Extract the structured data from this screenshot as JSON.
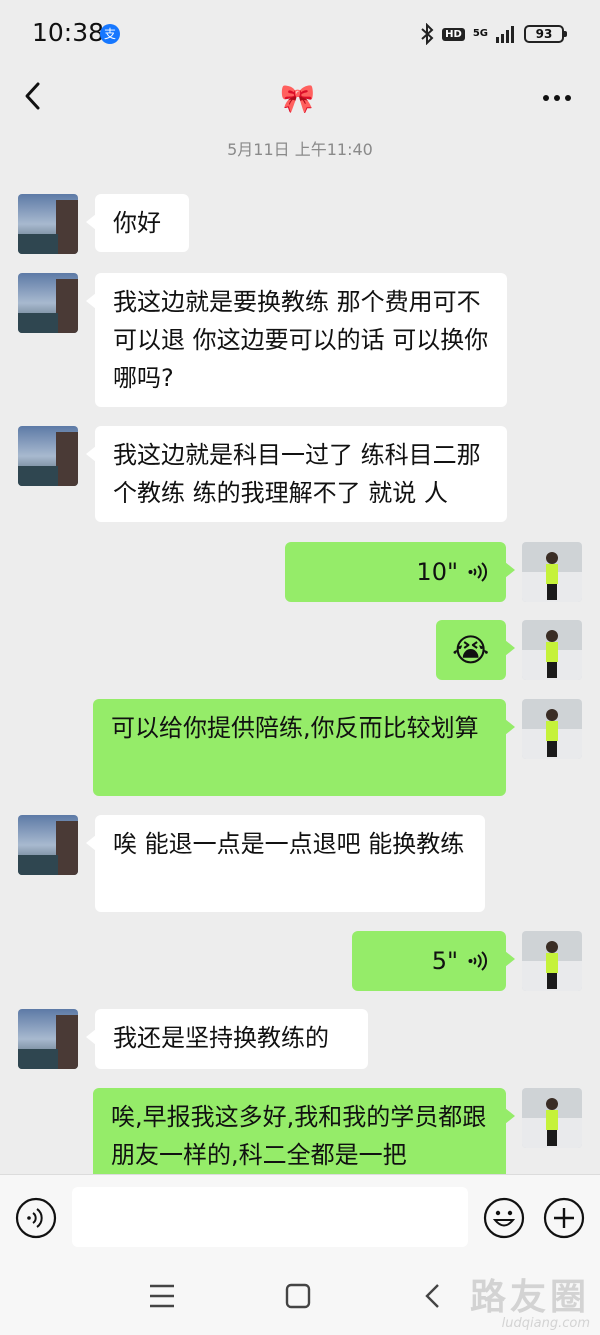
{
  "status_bar": {
    "time": "10:38",
    "app_badge": "支",
    "network": "5G",
    "hd": "HD",
    "battery": "93"
  },
  "header": {
    "title_emoji": "🎀"
  },
  "chat": {
    "timestamp": "5月11日 上午11:40",
    "messages": [
      {
        "side": "in",
        "type": "text",
        "text": "你好"
      },
      {
        "side": "in",
        "type": "text",
        "text": "我这边就是要换教练 那个费用可不可以退 你这边要可以的话 可以换你哪吗?"
      },
      {
        "side": "in",
        "type": "text",
        "text": "我这边就是科目一过了 练科目二那个教练 练的我理解不了 就说 人"
      },
      {
        "side": "out",
        "type": "voice",
        "duration": "10\""
      },
      {
        "side": "out",
        "type": "emoji",
        "emoji": "😭"
      },
      {
        "side": "out",
        "type": "text",
        "text": "可以给你提供陪练,你反而比较划算"
      },
      {
        "side": "in",
        "type": "text",
        "text": " 唉 能退一点是一点退吧 能换教练"
      },
      {
        "side": "out",
        "type": "voice",
        "duration": "5\""
      },
      {
        "side": "in",
        "type": "text",
        "text": " 我还是坚持换教练的"
      },
      {
        "side": "out",
        "type": "text",
        "text": "唉,早报我这多好,我和我的学员都跟朋友一样的,科二全都是一把"
      }
    ]
  },
  "input_bar": {
    "placeholder": "",
    "value": ""
  },
  "watermark": {
    "text": "路友圈",
    "url": "ludqiang.com"
  },
  "icons": {
    "back": "back-arrow-icon",
    "more": "more-dots-icon",
    "voice_toggle": "voice-mode-icon",
    "emoji": "emoji-smile-icon",
    "plus": "plus-icon"
  },
  "colors": {
    "background": "#ededed",
    "outgoing_bubble": "#95ec69",
    "incoming_bubble": "#ffffff",
    "timestamp": "#8a8a8a",
    "title_emoji": "#ff6fa8"
  }
}
